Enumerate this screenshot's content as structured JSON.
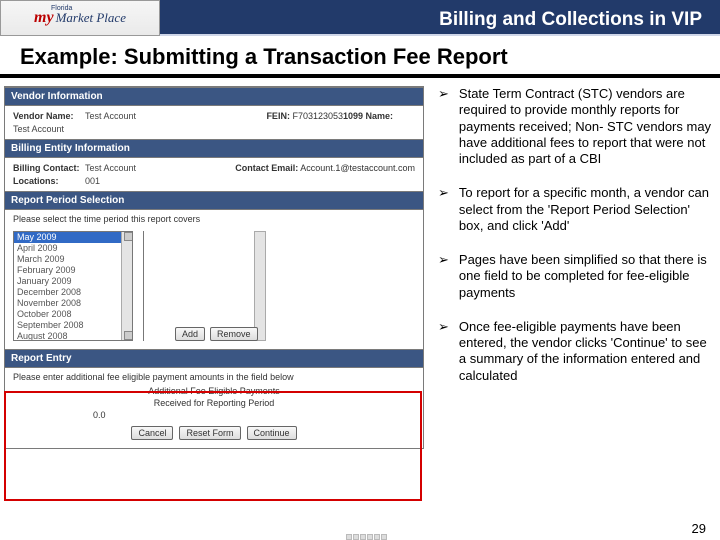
{
  "header": {
    "logo_my": "my",
    "logo_fl": "Florida",
    "logo_mp": "Market Place",
    "title": "Billing and Collections in VIP"
  },
  "subtitle": "Example:  Submitting a Transaction Fee Report",
  "form": {
    "sec1": {
      "title": "Vendor Information",
      "vendor_name_lbl": "Vendor Name:",
      "vendor_name": "Test Account",
      "ten99_lbl": "1099 Name:",
      "ten99": "Test Account",
      "fein_lbl": "FEIN:",
      "fein": "F703123053"
    },
    "sec2": {
      "title": "Billing Entity Information",
      "contact_lbl": "Billing Contact:",
      "contact": "Test Account",
      "email_lbl": "Contact Email:",
      "email": "Account.1@testaccount.com",
      "loc_lbl": "Locations:",
      "loc": "001"
    },
    "sec3": {
      "title": "Report Period Selection",
      "desc": "Please select the time period this report covers",
      "options": [
        "May 2009",
        "April 2009",
        "March 2009",
        "February 2009",
        "January 2009",
        "December 2008",
        "November 2008",
        "October 2008",
        "September 2008",
        "August 2008"
      ]
    },
    "sec4": {
      "title": "Report Entry",
      "desc": "Please enter additional fee eligible payment amounts in the field below",
      "line1": "Additional Fee Eligible Payments",
      "line2": "Received for Reporting Period",
      "value": "0.0"
    },
    "buttons": {
      "add": "Add",
      "remove": "Remove",
      "cancel": "Cancel",
      "reset": "Reset Form",
      "continue": "Continue"
    }
  },
  "bullets": [
    "State Term Contract (STC) vendors are required to provide monthly reports for payments received; Non- STC vendors may have additional fees to report that were not included as part of a CBI",
    "To report for a specific month, a vendor can select from the 'Report Period Selection' box, and click 'Add'",
    "Pages have been simplified so that there is one field to be completed for fee-eligible payments",
    "Once fee-eligible payments have been entered, the vendor clicks 'Continue' to see a summary of the information entered and calculated"
  ],
  "page_number": "29"
}
